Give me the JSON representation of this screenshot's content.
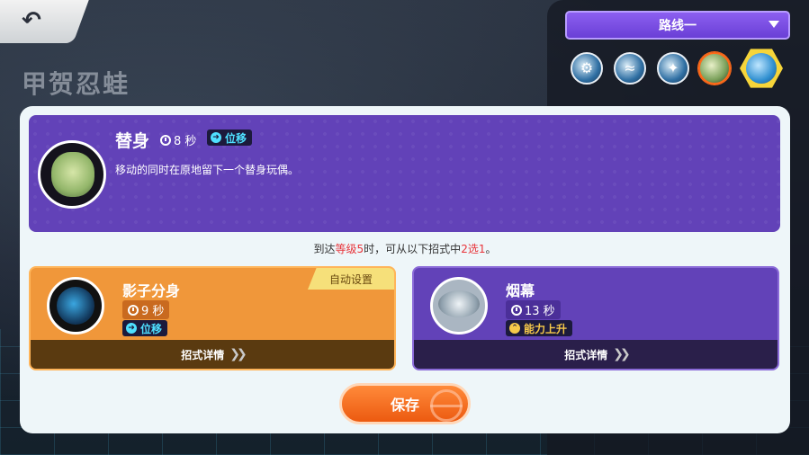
{
  "header": {
    "page_title": "甲贺忍蛙",
    "back_icon": "back-arrow-icon"
  },
  "route": {
    "selected": "路线一",
    "skills": [
      "skill-gear-icon",
      "skill-wave-icon",
      "skill-water-shuriken-icon",
      "skill-substitute-icon",
      "skill-unite-icon"
    ],
    "selected_index": 3
  },
  "current_move": {
    "name": "替身",
    "cooldown": "8 秒",
    "tag": "位移",
    "description": "移动的同时在原地留下一个替身玩偶。"
  },
  "upgrade": {
    "prefix": "到达",
    "level": "等级5",
    "middle": "时，可从以下招式中",
    "choice": "2选1",
    "suffix": "。"
  },
  "options": [
    {
      "name": "影子分身",
      "cooldown": "9 秒",
      "tag": "位移",
      "badge": "自动设置",
      "detail": "招式详情"
    },
    {
      "name": "烟幕",
      "cooldown": "13 秒",
      "tag": "能力上升",
      "detail": "招式详情"
    }
  ],
  "save_label": "保存",
  "colors": {
    "accent_orange": "#f0973a",
    "accent_purple": "#6242b8",
    "highlight_red": "#e8343a"
  }
}
